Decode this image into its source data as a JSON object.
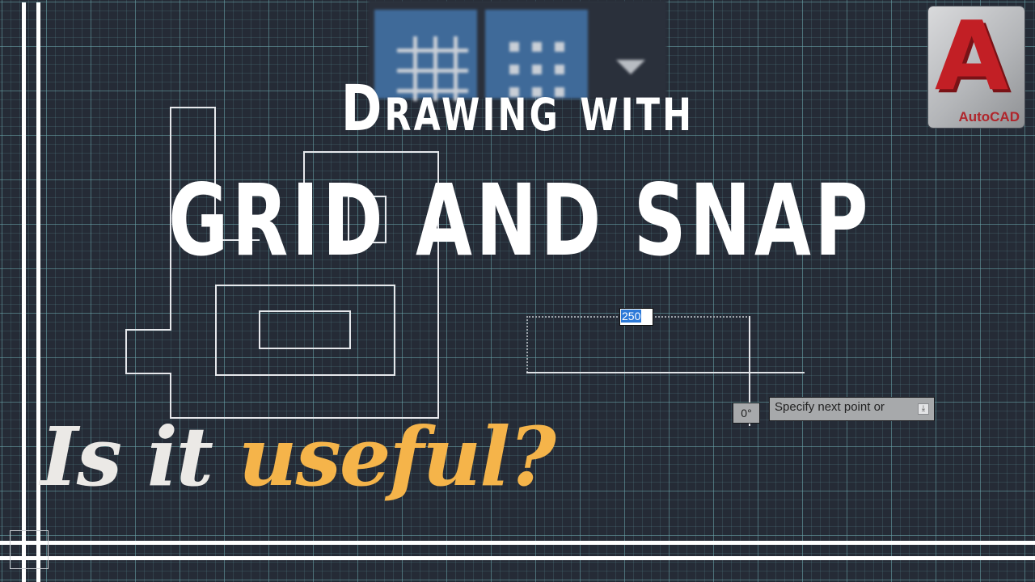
{
  "title": {
    "line1": "Drawing with",
    "line2": "GRID AND SNAP"
  },
  "subtitle": {
    "part1": "Is it ",
    "part2": "useful?"
  },
  "toolbar": {
    "buttons": [
      {
        "icon": "grid-display-icon",
        "state": "active"
      },
      {
        "icon": "snap-mode-icon",
        "state": "active"
      },
      {
        "icon": "dropdown-arrow-icon",
        "state": "inactive"
      }
    ]
  },
  "logo": {
    "letter": "A",
    "text": "AutoCAD"
  },
  "dynamic_input": {
    "value": "250",
    "angle": "0°",
    "prompt": "Specify next point or",
    "prompt_button_glyph": "⤓"
  },
  "colors": {
    "background": "#252b36",
    "grid_line": "#6eaaaf",
    "title_white": "#ffffff",
    "accent_yellow": "#f5b44a",
    "logo_red": "#c21f25",
    "selection_blue": "#2c79d8"
  }
}
